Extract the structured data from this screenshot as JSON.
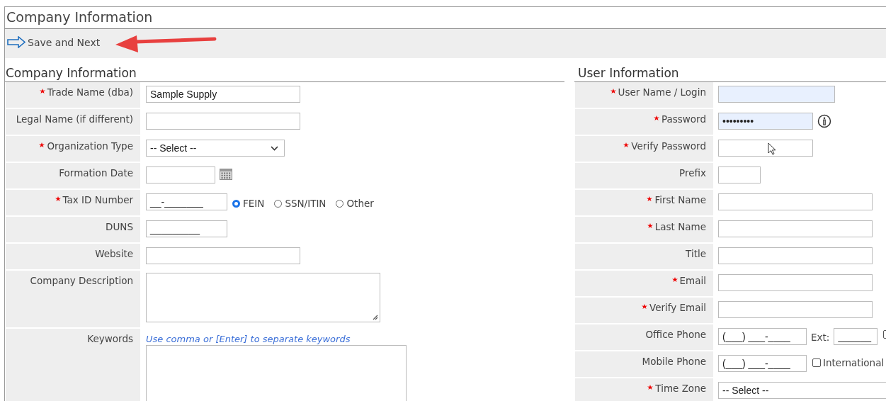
{
  "page_title": "Company Information",
  "toolbar": {
    "save_button": "Save and Next"
  },
  "company": {
    "heading": "Company Information",
    "fields": [
      {
        "label": "Trade Name (dba)",
        "required": true,
        "kind": "text",
        "value": "Sample Supply"
      },
      {
        "label": "Legal Name (if different)",
        "required": false,
        "kind": "text"
      },
      {
        "label": "Organization Type",
        "required": true,
        "kind": "select",
        "value": "-- Select --"
      },
      {
        "label": "Formation Date",
        "required": false,
        "kind": "date"
      },
      {
        "label": "Tax ID Number",
        "required": true,
        "kind": "taxid",
        "value": "__-_______",
        "options": [
          {
            "label": "FEIN",
            "selected": true
          },
          {
            "label": "SSN/ITIN",
            "selected": false
          },
          {
            "label": "Other",
            "selected": false
          }
        ]
      },
      {
        "label": "DUNS",
        "required": false,
        "kind": "mask",
        "value": "_________"
      },
      {
        "label": "Website",
        "required": false,
        "kind": "text"
      },
      {
        "label": "Company Description",
        "required": false,
        "kind": "textarea"
      },
      {
        "label": "Keywords",
        "required": false,
        "kind": "keywords",
        "hint": "Use comma or [Enter] to separate keywords"
      }
    ]
  },
  "user": {
    "heading": "User Information",
    "fields": [
      {
        "label": "User Name / Login",
        "required": true,
        "kind": "login",
        "autofilled": true
      },
      {
        "label": "Password",
        "required": true,
        "kind": "password",
        "value": "•••••••••",
        "autofilled": true,
        "info_icon": true
      },
      {
        "label": "Verify Password",
        "required": true,
        "kind": "password",
        "autofilled": false,
        "info_icon": false
      },
      {
        "label": "Prefix",
        "required": false,
        "kind": "prefix"
      },
      {
        "label": "First Name",
        "required": true,
        "kind": "text"
      },
      {
        "label": "Last Name",
        "required": true,
        "kind": "text"
      },
      {
        "label": "Title",
        "required": false,
        "kind": "text"
      },
      {
        "label": "Email",
        "required": true,
        "kind": "text"
      },
      {
        "label": "Verify Email",
        "required": true,
        "kind": "text"
      },
      {
        "label": "Office Phone",
        "required": false,
        "kind": "phone",
        "value": "(___) ___-____",
        "ext_label": "Ext:",
        "ext_value": "______",
        "checkbox": {
          "checked": false
        }
      },
      {
        "label": "Mobile Phone",
        "required": false,
        "kind": "phone",
        "value": "(___) ___-____",
        "checkbox": {
          "checked": false,
          "label": "International"
        }
      },
      {
        "label": "Time Zone",
        "required": true,
        "kind": "select",
        "value": "-- Select --"
      }
    ]
  }
}
